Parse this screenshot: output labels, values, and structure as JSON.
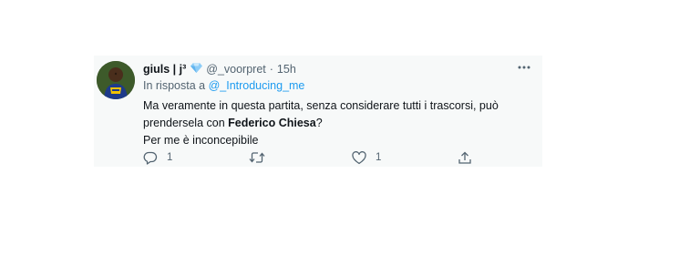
{
  "tweet": {
    "author_name": "giuls | j³",
    "verified_badge_icon": "diamond-icon",
    "handle": "@_voorpret",
    "separator": "·",
    "time": "15h",
    "reply_prefix": "In risposta a",
    "reply_to": "@_Introducing_me",
    "text_line1": "Ma veramente in questa partita, senza considerare tutti i trascorsi, può",
    "text_line2_before": "prendersela con",
    "text_line2_bold": "Federico Chiesa",
    "text_line2_after": "?",
    "text_line3": "Per me è inconcepibile",
    "actions": {
      "reply_count": "1",
      "retweet_count": "",
      "like_count": "1"
    }
  },
  "colors": {
    "text": "#0f1419",
    "secondary": "#536471",
    "link": "#1d9bf0",
    "diamond": "#8ecdf7",
    "card_bg": "#f7f9f9"
  }
}
